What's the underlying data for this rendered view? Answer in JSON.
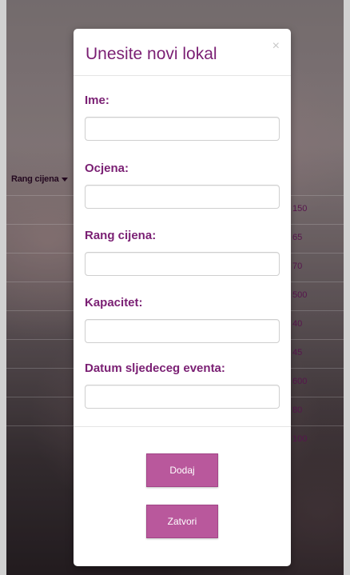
{
  "background": {
    "column_header": "Rang cijena",
    "prices": [
      "150",
      "65",
      "70",
      "500",
      "40",
      "45",
      "600",
      "80",
      "100"
    ]
  },
  "modal": {
    "title": "Unesite novi lokal",
    "close_symbol": "×",
    "fields": [
      {
        "label": "Ime:",
        "value": "",
        "placeholder": ""
      },
      {
        "label": "Ocjena:",
        "value": "",
        "placeholder": ""
      },
      {
        "label": "Rang cijena:",
        "value": "",
        "placeholder": ""
      },
      {
        "label": "Kapacitet:",
        "value": "",
        "placeholder": ""
      },
      {
        "label": "Datum sljedeceg eventa:",
        "value": "",
        "placeholder": ""
      }
    ],
    "buttons": {
      "add_label": "Dodaj",
      "close_label": "Zatvori"
    }
  },
  "colors": {
    "accent": "#7a1f73",
    "button": "#b9589c"
  }
}
